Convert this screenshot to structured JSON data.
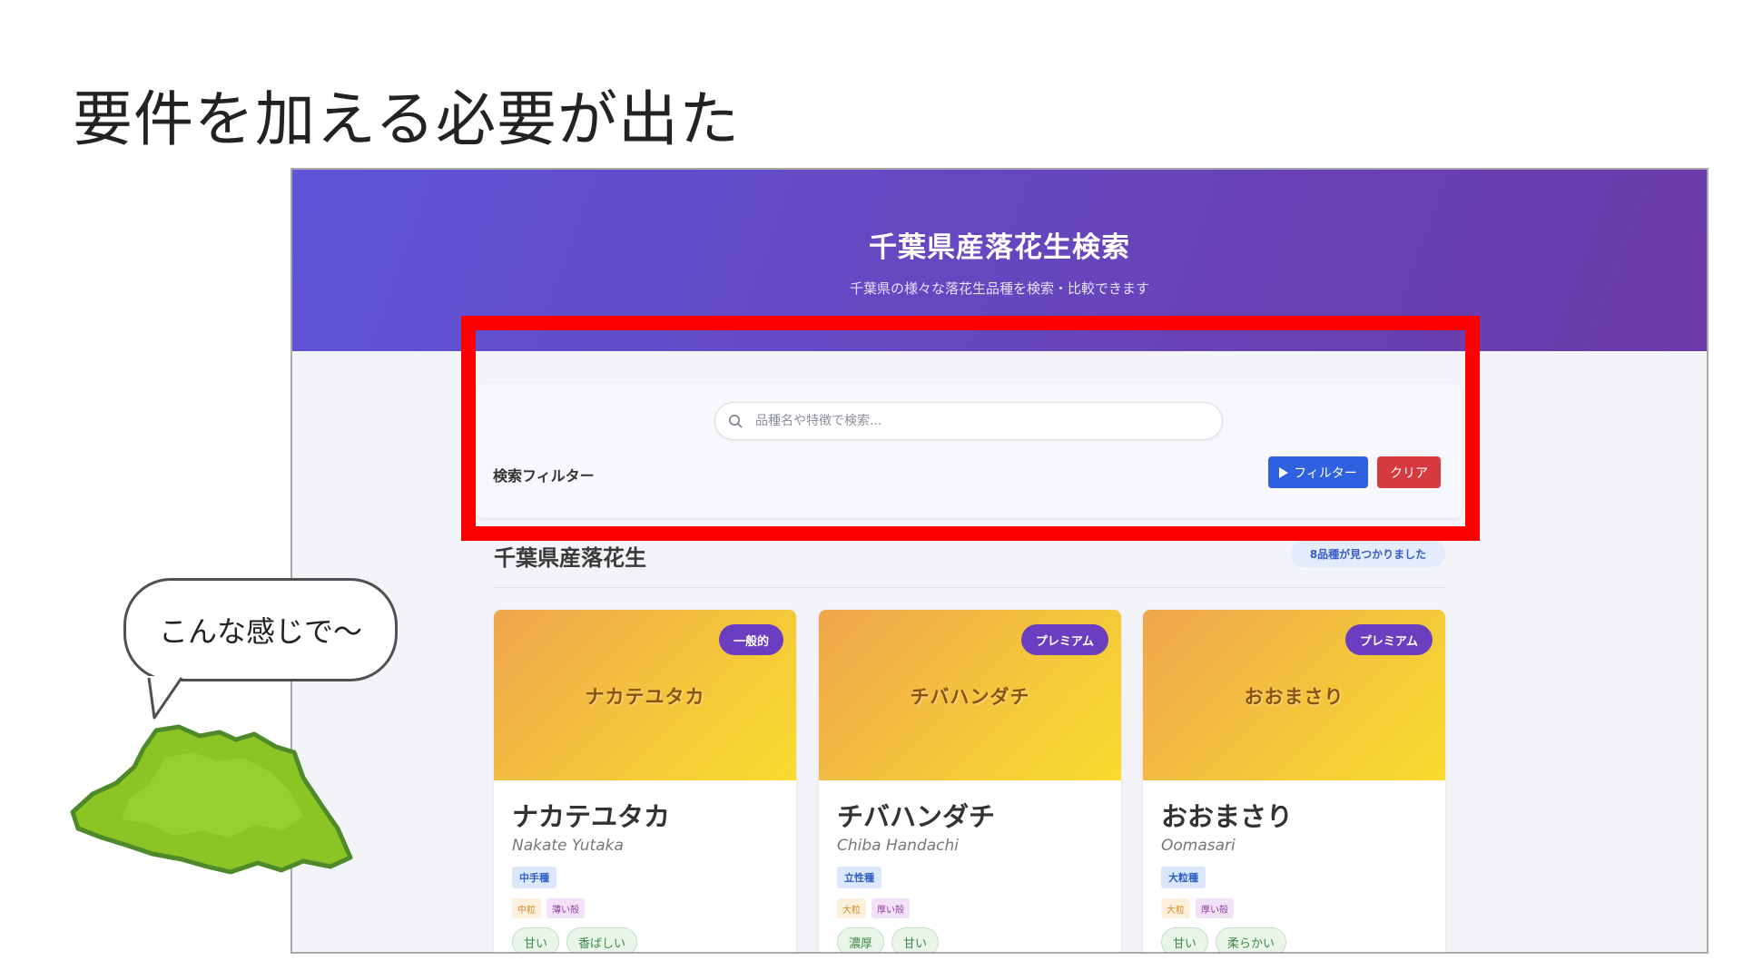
{
  "slide": {
    "title": "要件を加える必要が出た",
    "speech_bubble": "こんな感じで〜"
  },
  "app": {
    "title": "千葉県産落花生検索",
    "subtitle": "千葉県の様々な落花生品種を検索・比較できます",
    "search": {
      "placeholder": "品種名や特徴で検索...",
      "value": ""
    },
    "filter_label": "検索フィルター",
    "filter_button": "フィルター",
    "clear_button": "クリア",
    "results_title": "千葉県産落花生",
    "results_count": "8品種が見つかりました",
    "cards": [
      {
        "badge": "一般的",
        "name": "ナカテユタカ",
        "roman": "Nakate Yutaka",
        "type": "中手種",
        "size": "中粒",
        "shell": "薄い殻",
        "tastes": [
          "甘い",
          "香ばしい"
        ]
      },
      {
        "badge": "プレミアム",
        "name": "チバハンダチ",
        "roman": "Chiba Handachi",
        "type": "立性種",
        "size": "大粒",
        "shell": "厚い殻",
        "tastes": [
          "濃厚",
          "甘い"
        ]
      },
      {
        "badge": "プレミアム",
        "name": "おおまさり",
        "roman": "Oomasari",
        "type": "大粒種",
        "size": "大粒",
        "shell": "厚い殻",
        "tastes": [
          "甘い",
          "柔らかい"
        ]
      }
    ]
  },
  "colors": {
    "header_gradient_start": "#5f54d8",
    "header_gradient_end": "#6a3aa8",
    "filter_button": "#2f60e0",
    "clear_button": "#d53a3f",
    "highlight_frame": "#fc0000",
    "card_gradient_start": "#eea64c",
    "card_gradient_end": "#f8dc2e",
    "badge": "#6b3ec0",
    "mascot": "#8bc424"
  },
  "icons": {
    "search": "search-icon",
    "filter": "play-triangle-icon",
    "mascot": "chiba-prefecture-map-icon"
  }
}
